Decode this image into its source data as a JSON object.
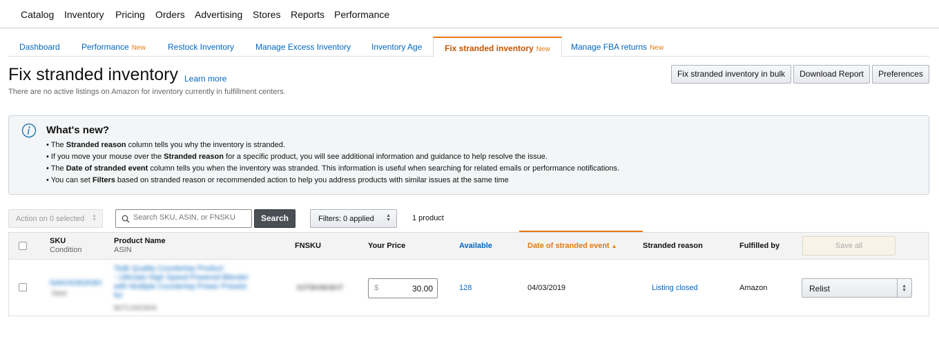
{
  "topnav": [
    "Catalog",
    "Inventory",
    "Pricing",
    "Orders",
    "Advertising",
    "Stores",
    "Reports",
    "Performance"
  ],
  "tabs": [
    {
      "label": "Dashboard",
      "badge": ""
    },
    {
      "label": "Performance",
      "badge": "New"
    },
    {
      "label": "Restock Inventory",
      "badge": ""
    },
    {
      "label": "Manage Excess Inventory",
      "badge": ""
    },
    {
      "label": "Inventory Age",
      "badge": ""
    },
    {
      "label": "Fix stranded inventory",
      "badge": "New"
    },
    {
      "label": "Manage FBA returns",
      "badge": "New"
    }
  ],
  "header": {
    "title": "Fix stranded inventory",
    "learn_more": "Learn more",
    "subtitle": "There are no active listings on Amazon for inventory currently in fulfillment centers.",
    "buttons": {
      "bulk": "Fix stranded inventory in bulk",
      "download": "Download Report",
      "preferences": "Preferences"
    }
  },
  "whats_new": {
    "title": "What's new?",
    "bullets": [
      [
        "• The ",
        "Stranded reason",
        " column tells you why the inventory is stranded."
      ],
      [
        "• If you move your mouse over the ",
        "Stranded reason",
        " for a specific product, you will see additional information and guidance to help resolve the issue."
      ],
      [
        "• The ",
        "Date of stranded event",
        " column tells you when the inventory was stranded. This information is useful when searching for related emails or performance notifications."
      ],
      [
        "• You can set ",
        "Filters",
        " based on stranded reason or recommended action to help you address products with similar issues at the same time"
      ]
    ]
  },
  "toolbar": {
    "action": "Action on 0 selected",
    "search_placeholder": "Search SKU, ASIN, or FNSKU",
    "search_button": "Search",
    "filters": "Filters: 0 applied",
    "count": "1 product"
  },
  "table": {
    "headers": {
      "sku": "SKU",
      "condition": "Condition",
      "product_name": "Product Name",
      "asin": "ASIN",
      "fnsku": "FNSKU",
      "price": "Your Price",
      "available": "Available",
      "date": "Date of stranded event",
      "reason": "Stranded reason",
      "fulfilled": "Fulfilled by",
      "save_all": "Save all"
    },
    "row": {
      "sku": "NAKHG8GK8H",
      "condition": "New",
      "product_name_lines": [
        "Tsdk Quality Countertop Product",
        "- Ultimate High Speed Powered Blender",
        "with Multiple Countertop Power Presets",
        "for"
      ],
      "asin": "B07LK8G9HK",
      "fnsku": "X0T8H9K8HT",
      "currency": "$",
      "price": "30.00",
      "available": "128",
      "date": "04/03/2019",
      "reason": "Listing closed",
      "fulfilled": "Amazon",
      "action": "Relist"
    }
  }
}
